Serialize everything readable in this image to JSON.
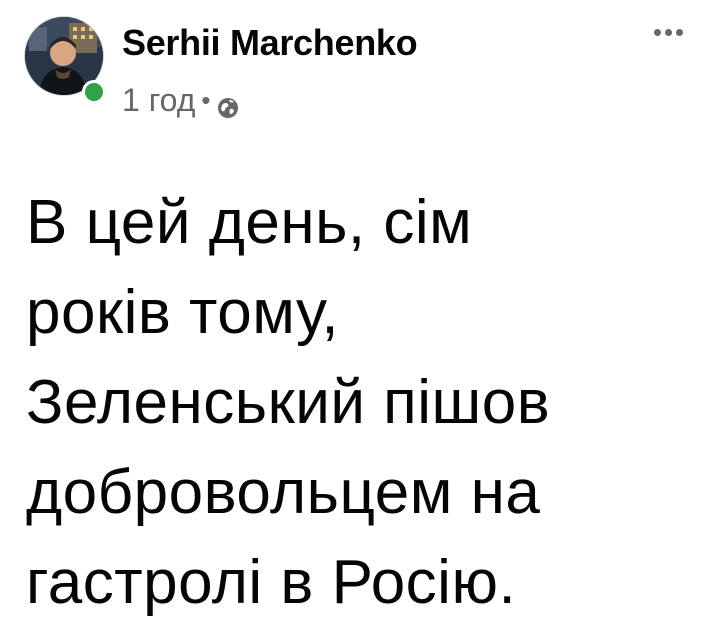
{
  "post": {
    "author": {
      "name": "Serhii Marchenko",
      "avatar_icon": "profile-photo",
      "online": true,
      "online_color": "#31a24c"
    },
    "meta": {
      "time": "1 год",
      "separator": "•",
      "audience_icon": "globe-icon"
    },
    "menu_icon": "more-horizontal-icon",
    "text_lines": [
      "В цей день, сім",
      "років тому,",
      "Зеленський пішов",
      "добровольцем на",
      "гастролі в Росію."
    ]
  },
  "colors": {
    "primary_text": "#050505",
    "secondary_text": "#65676b"
  }
}
